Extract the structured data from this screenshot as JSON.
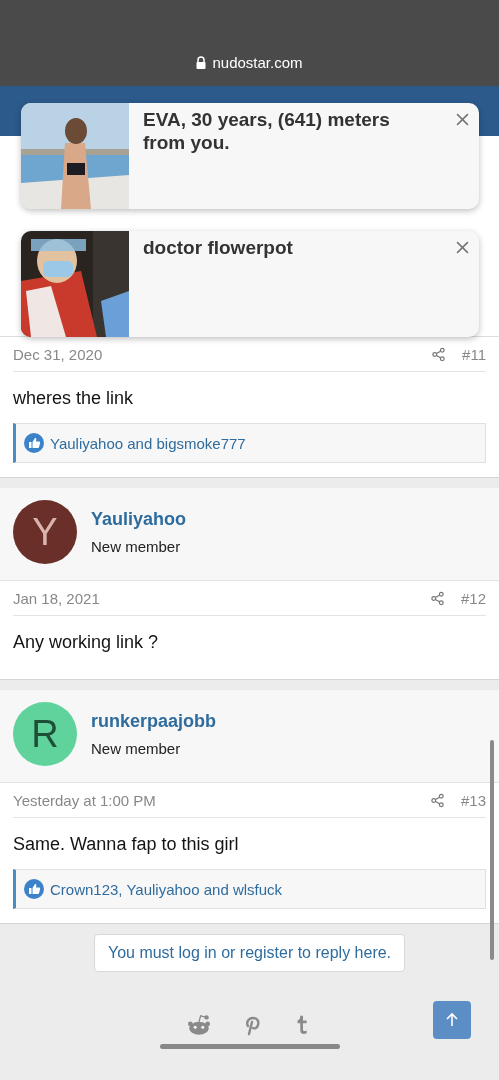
{
  "browser": {
    "url": "nudostar.com"
  },
  "ads": [
    {
      "title": "EVA, 30 years, (641) meters from you.",
      "kind": "picture"
    },
    {
      "title": "doctor flowerpot",
      "kind": "picture"
    }
  ],
  "posts": [
    {
      "date": "Dec 31, 2020",
      "number": "#11",
      "body": "wheres the link",
      "reactions": "Yauliyahoo and bigsmoke777"
    },
    {
      "author": "Yauliyahoo",
      "role": "New member",
      "avatar": "Y",
      "color": "#6b2f2a",
      "date": "Jan 18, 2021",
      "number": "#12",
      "body": "Any working link ?"
    },
    {
      "author": "runkerpaajobb",
      "role": "New member",
      "avatar": "R",
      "color": "#5fd39b",
      "date": "Yesterday at 1:00 PM",
      "number": "#13",
      "body": "Same. Wanna fap to this girl",
      "reactions": "Crown123, Yauliyahoo and wlsfuck"
    }
  ],
  "reply_notice": "You must log in or register to reply here."
}
